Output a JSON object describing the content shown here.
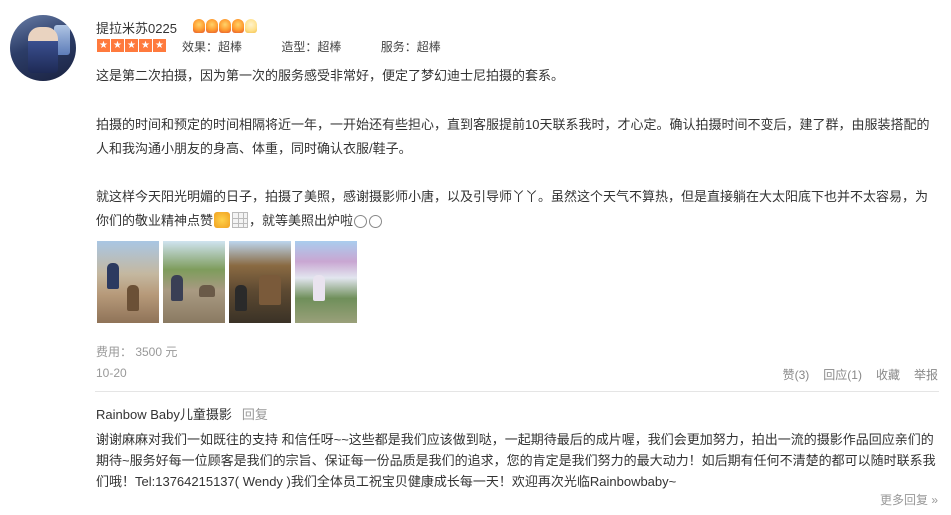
{
  "user": {
    "name": "提拉米苏0225",
    "rating_stars": 5,
    "badges_filled": 4,
    "badges_total": 5
  },
  "scores": [
    {
      "label": "效果：超棒"
    },
    {
      "label": "造型：超棒"
    },
    {
      "label": "服务：超棒"
    }
  ],
  "review": {
    "p1": "这是第二次拍摄，因为第一次的服务感受非常好，便定了梦幻迪士尼拍摄的套系。",
    "p2": "拍摄的时间和预定的时间相隔将近一年，一开始还有些担心，直到客服提前10天联系我时，才心定。确认拍摄时间不变后，建了群，由服装搭配的人和我沟通小朋友的身高、体重，同时确认衣服/鞋子。",
    "p3a": "就这样今天阳光明媚的日子，拍摄了美照，感谢摄影师小唐，以及引导师丫丫。虽然这个天气不算热，但是直接躺在大太阳底下也并不太容易，为你们的敬业精神点赞",
    "p3b": "，就等美照出炉啦"
  },
  "fee": "费用： 3500 元",
  "date": "10-20",
  "actions": {
    "like": "赞(3)",
    "reply": "回应(1)",
    "collect": "收藏",
    "report": "举报"
  },
  "merchant_reply": {
    "name": "Rainbow Baby儿童摄影",
    "reply_link": "回复",
    "text": "谢谢麻麻对我们一如既往的支持 和信任呀~~这些都是我们应该做到哒，一起期待最后的成片喔，我们会更加努力，拍出一流的摄影作品回应亲们的期待~服务好每一位顾客是我们的宗旨、保证每一份品质是我们的追求，您的肯定是我们努力的最大动力！如后期有任何不清楚的都可以随时联系我们哦！Tel:13764215137( Wendy )我们全体员工祝宝贝健康成长每一天！欢迎再次光临Rainbowbaby~"
  },
  "more_replies": "更多回复 »"
}
